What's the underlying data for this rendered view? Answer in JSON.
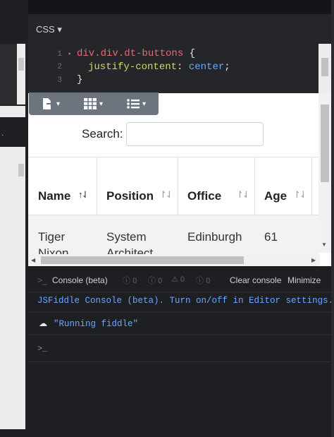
{
  "css_panel": {
    "label": "CSS ▾"
  },
  "editor": {
    "lines": [
      {
        "num": "1",
        "selector": "div.div.dt-buttons",
        "rest": " {"
      },
      {
        "num": "2",
        "property": "justify-content",
        "value": "center",
        "end": ";"
      },
      {
        "num": "3",
        "close": "}"
      }
    ]
  },
  "result": {
    "buttons": [
      {
        "icon": "file-export-icon",
        "caret": "▾"
      },
      {
        "icon": "grid-icon",
        "caret": "▾"
      },
      {
        "icon": "list-icon",
        "caret": "▾"
      }
    ],
    "search_label": "Search:",
    "search_value": "",
    "columns": [
      "Name",
      "Position",
      "Office",
      "Age"
    ],
    "sort_active": "↑⇃",
    "sort_inactive": "↾⇃",
    "rows": [
      {
        "name": "Tiger Nixon",
        "position": "System Architect",
        "office": "Edinburgh",
        "age": "61"
      }
    ]
  },
  "console": {
    "title": "Console (beta)",
    "prompt": ">_",
    "counts": [
      "0",
      "0",
      "0",
      "0"
    ],
    "clear_label": "Clear console",
    "minimize_label": "Minimize",
    "info_message": "JSFiddle Console (beta). Turn on/off in Editor settings.",
    "log_message": "\"Running fiddle\"",
    "input_prompt": ">_"
  },
  "colors": {
    "accent": "#6aa7ff",
    "button_gray": "#6c757d",
    "selector": "#e06c75",
    "property": "#d7d75f"
  }
}
